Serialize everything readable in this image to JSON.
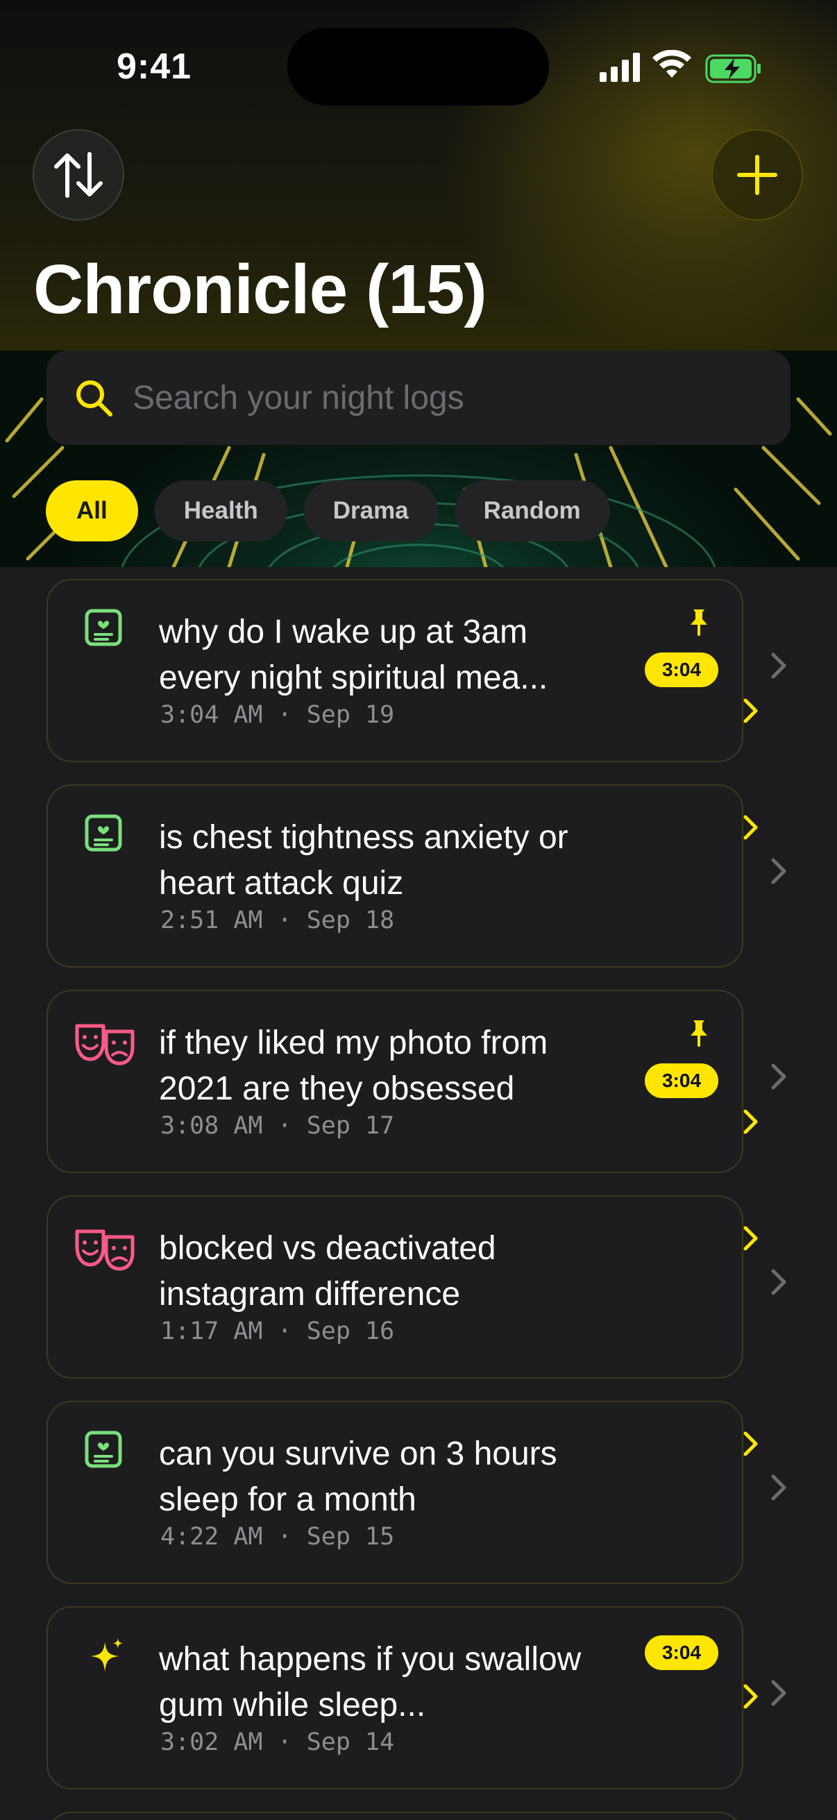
{
  "status": {
    "time": "9:41"
  },
  "header": {
    "title": "Chronicle (15)"
  },
  "search": {
    "placeholder": "Search your night logs",
    "value": ""
  },
  "filters": [
    {
      "label": "All",
      "active": true
    },
    {
      "label": "Health",
      "active": false
    },
    {
      "label": "Drama",
      "active": false
    },
    {
      "label": "Random",
      "active": false
    }
  ],
  "logs": [
    {
      "title": "why do I wake up at 3am every night spiritual mea...",
      "time": "3:04 AM",
      "date": "Sep 19",
      "category": "health",
      "icon": "health-note-icon",
      "pinned": true,
      "badge": "3:04"
    },
    {
      "title": "is chest tightness anxiety or heart attack quiz",
      "time": "2:51 AM",
      "date": "Sep 18",
      "category": "health",
      "icon": "health-note-icon",
      "pinned": false,
      "badge": ""
    },
    {
      "title": "if they liked my photo from 2021 are they obsessed",
      "time": "3:08 AM",
      "date": "Sep 17",
      "category": "drama",
      "icon": "drama-masks-icon",
      "pinned": true,
      "badge": "3:04"
    },
    {
      "title": "blocked vs deactivated instagram difference",
      "time": "1:17 AM",
      "date": "Sep 16",
      "category": "drama",
      "icon": "drama-masks-icon",
      "pinned": false,
      "badge": ""
    },
    {
      "title": "can you survive on 3 hours sleep for a month",
      "time": "4:22 AM",
      "date": "Sep 15",
      "category": "health",
      "icon": "health-note-icon",
      "pinned": false,
      "badge": ""
    },
    {
      "title": "what happens if you swallow gum while sleep...",
      "time": "3:02 AM",
      "date": "Sep 14",
      "category": "random",
      "icon": "sparkles-icon",
      "pinned": false,
      "badge": "3:04"
    }
  ],
  "colors": {
    "accent": "#ffe600",
    "health": "#7be07b",
    "drama": "#ff5a87",
    "random": "#ffe600",
    "card_border": "#3b3a20"
  }
}
